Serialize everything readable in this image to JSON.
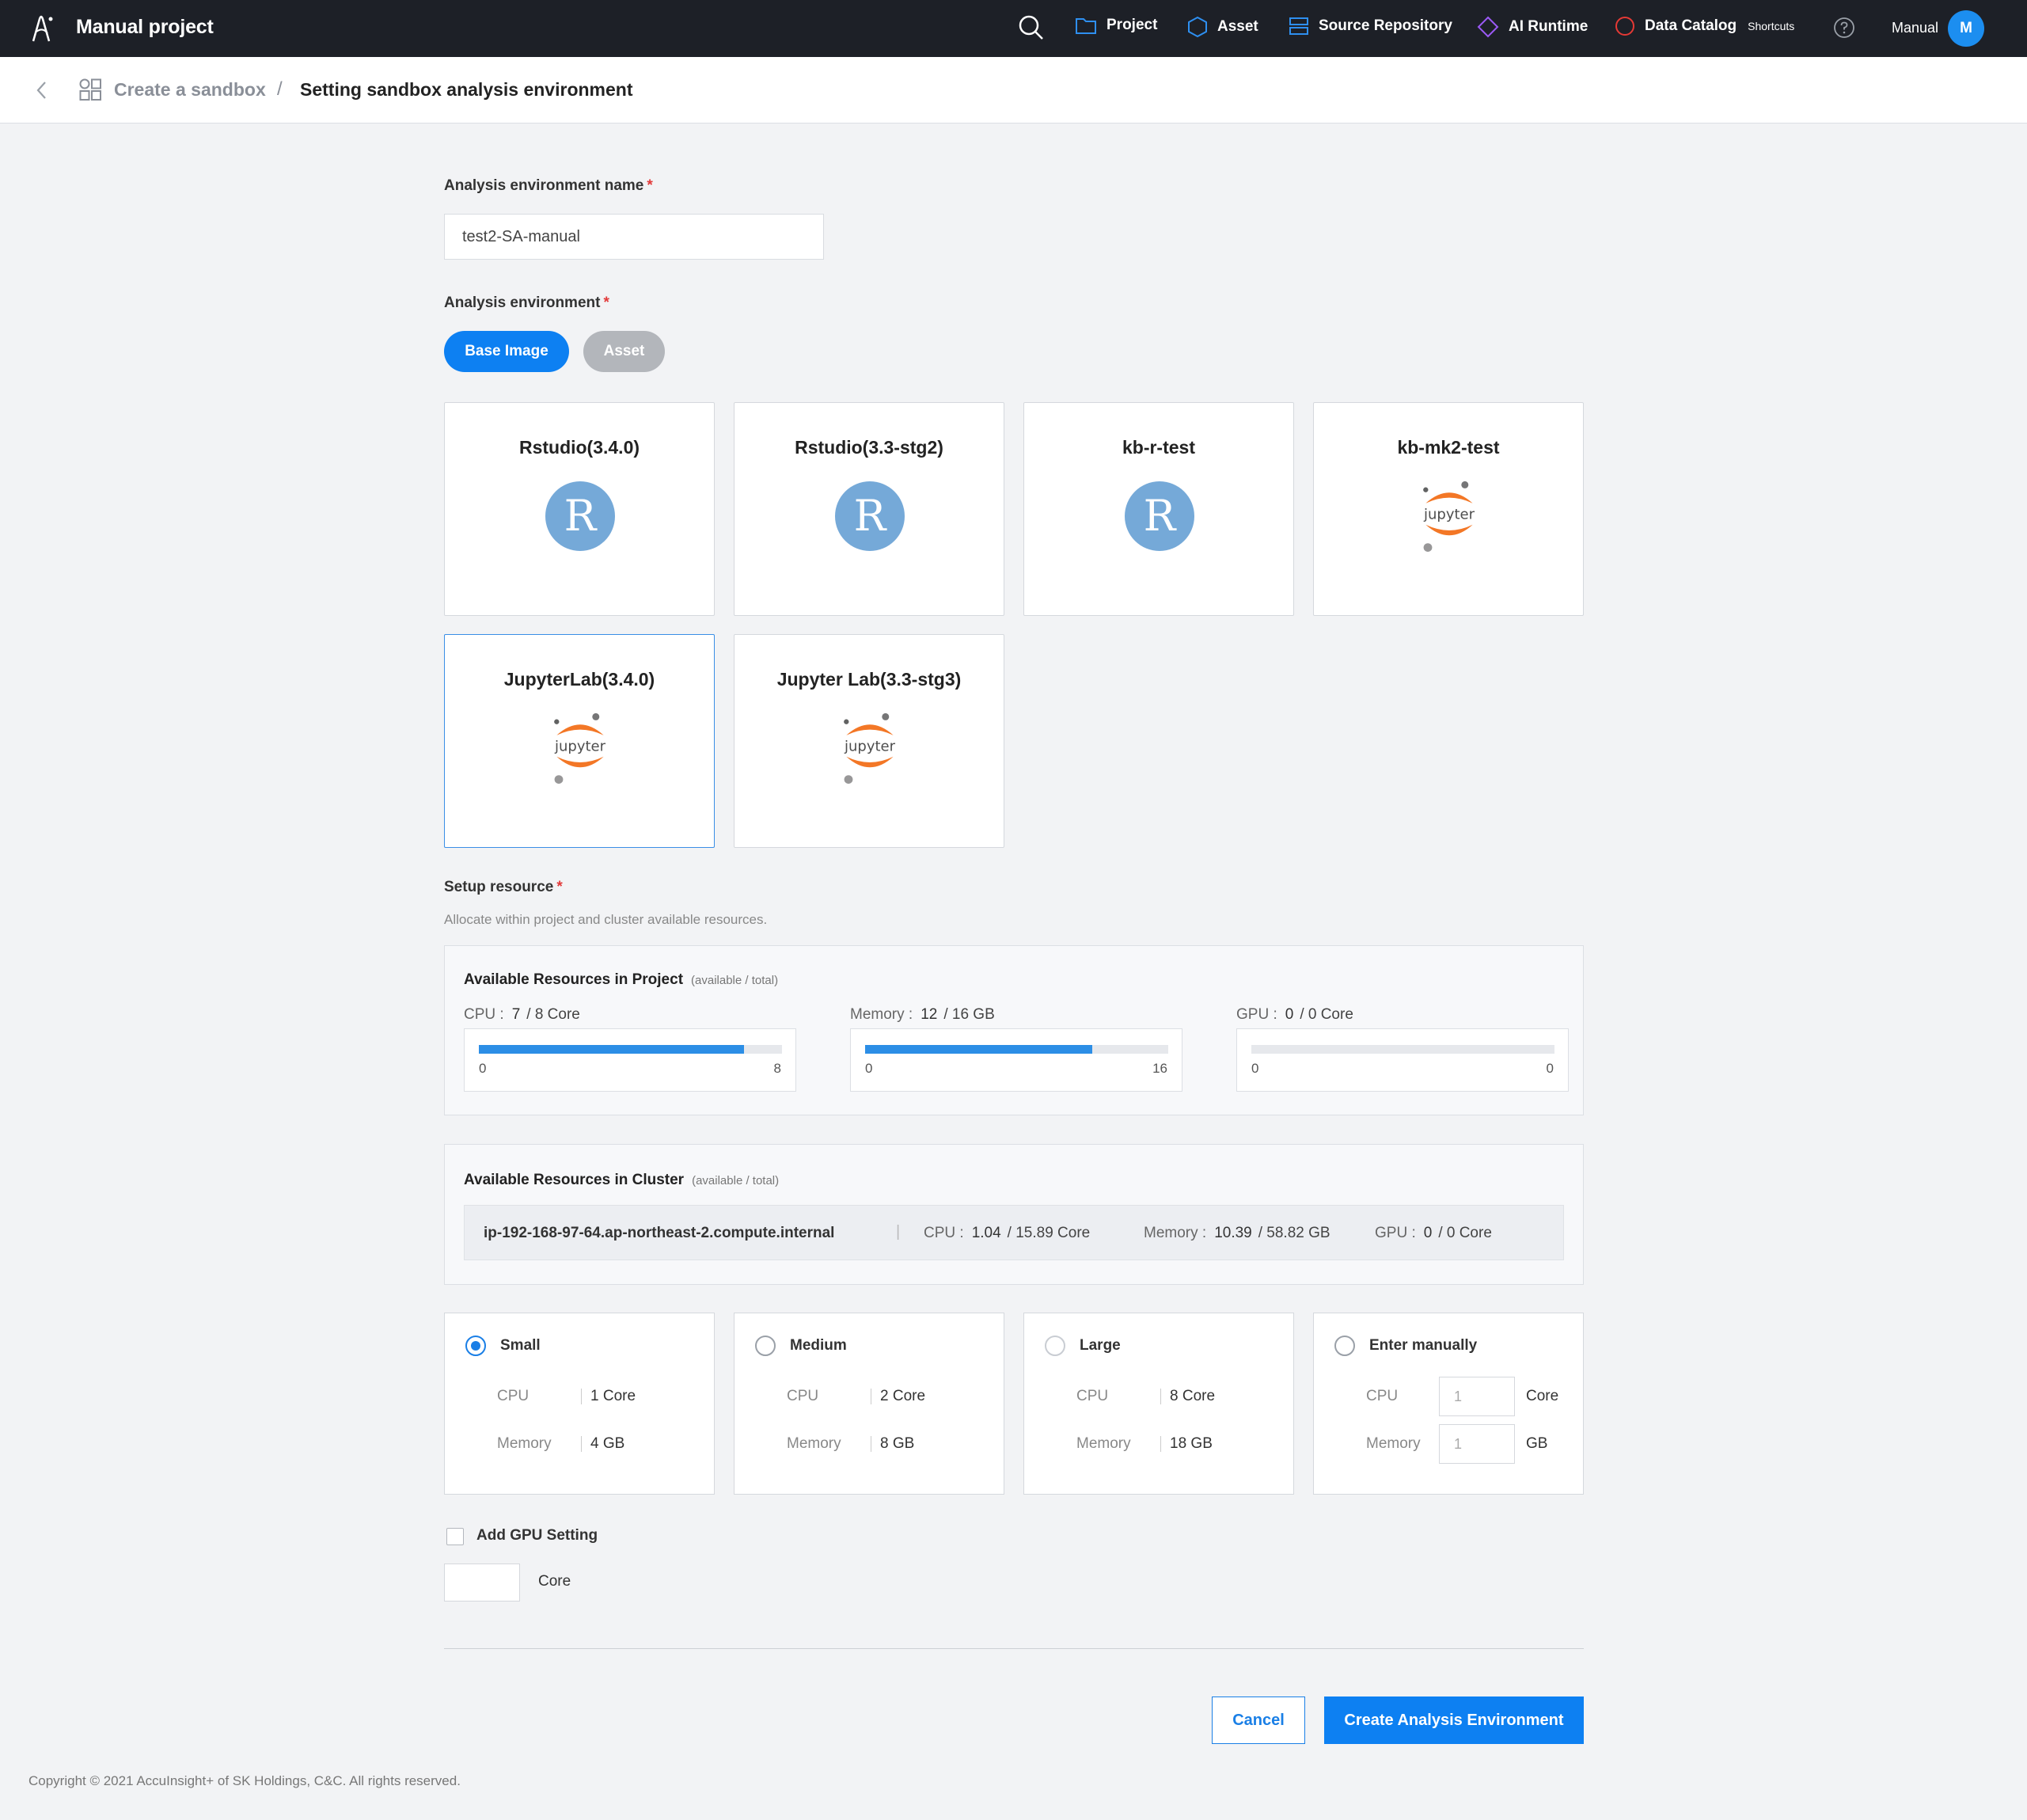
{
  "header": {
    "app_title": "Manual project",
    "nav": [
      {
        "label": "Project",
        "icon": "folder-icon",
        "color": "#2e8ff0"
      },
      {
        "label": "Asset",
        "icon": "hexagon-icon",
        "color": "#2e8ff0"
      },
      {
        "label": "Source Repository",
        "icon": "server-icon",
        "color": "#2e8ff0"
      },
      {
        "label": "AI Runtime",
        "icon": "diamond-icon",
        "color": "#9b59f5"
      },
      {
        "label": "Data Catalog",
        "icon": "circle-icon",
        "color": "#e53935"
      }
    ],
    "shortcuts_label": "Shortcuts",
    "user_name": "Manual",
    "avatar_initial": "M"
  },
  "breadcrumb": {
    "parent": "Create a sandbox",
    "separator": "/",
    "current": "Setting sandbox analysis environment"
  },
  "form": {
    "env_name_label": "Analysis environment name",
    "env_name_value": "test2-SA-manual",
    "env_label": "Analysis environment",
    "required_mark": "*",
    "tabs": {
      "base_image": "Base Image",
      "asset": "Asset",
      "active": "Base Image"
    },
    "images": [
      {
        "name": "Rstudio(3.4.0)",
        "icon": "r-logo-icon",
        "selected": false
      },
      {
        "name": "Rstudio(3.3-stg2)",
        "icon": "r-logo-icon",
        "selected": false
      },
      {
        "name": "kb-r-test",
        "icon": "r-logo-icon",
        "selected": false
      },
      {
        "name": "kb-mk2-test",
        "icon": "jupyter-logo-icon",
        "selected": false
      },
      {
        "name": "JupyterLab(3.4.0)",
        "icon": "jupyter-logo-icon",
        "selected": true
      },
      {
        "name": "Jupyter Lab(3.3-stg3)",
        "icon": "jupyter-logo-icon",
        "selected": false
      }
    ],
    "r_logo_letter": "R",
    "jupyter_logo_text": "jupyter",
    "resource_label": "Setup resource",
    "resource_hint": "Allocate within project and cluster available resources."
  },
  "project_resources": {
    "title": "Available Resources in Project",
    "note": "(available / total)",
    "cpu": {
      "label": "CPU :",
      "available": "7",
      "total": "/ 8 Core",
      "min": "0",
      "max": "8",
      "fraction": 0.875
    },
    "memory": {
      "label": "Memory :",
      "available": "12",
      "total": "/ 16 GB",
      "min": "0",
      "max": "16",
      "fraction": 0.75
    },
    "gpu": {
      "label": "GPU :",
      "available": "0",
      "total": "/ 0 Core",
      "min": "0",
      "max": "0",
      "fraction": 0
    }
  },
  "cluster_resources": {
    "title": "Available Resources in Cluster",
    "note": "(available / total)",
    "host": "ip-192-168-97-64.ap-northeast-2.compute.internal",
    "separator": "|",
    "cpu": {
      "label": "CPU :",
      "available": "1.04",
      "total": "/ 15.89 Core"
    },
    "memory": {
      "label": "Memory :",
      "available": "10.39",
      "total": "/ 58.82 GB"
    },
    "gpu": {
      "label": "GPU :",
      "available": "0",
      "total": "/ 0 Core"
    }
  },
  "sizes": [
    {
      "name": "Small",
      "cpu_label": "CPU",
      "cpu": "1 Core",
      "mem_label": "Memory",
      "mem": "4 GB",
      "selected": true
    },
    {
      "name": "Medium",
      "cpu_label": "CPU",
      "cpu": "2 Core",
      "mem_label": "Memory",
      "mem": "8 GB",
      "selected": false
    },
    {
      "name": "Large",
      "cpu_label": "CPU",
      "cpu": "8 Core",
      "mem_label": "Memory",
      "mem": "18 GB",
      "selected": false
    },
    {
      "name": "Enter manually",
      "cpu_label": "CPU",
      "cpu_placeholder": "1",
      "cpu_unit": "Core",
      "mem_label": "Memory",
      "mem_placeholder": "1",
      "mem_unit": "GB",
      "selected": false
    }
  ],
  "gpu_setting": {
    "label": "Add GPU Setting",
    "unit": "Core",
    "checked": false
  },
  "actions": {
    "cancel": "Cancel",
    "create": "Create Analysis Environment",
    "primary_color": "#0d80f2"
  },
  "footer": {
    "copyright": "Copyright © 2021 AccuInsight+ of SK Holdings, C&C. All rights reserved."
  }
}
